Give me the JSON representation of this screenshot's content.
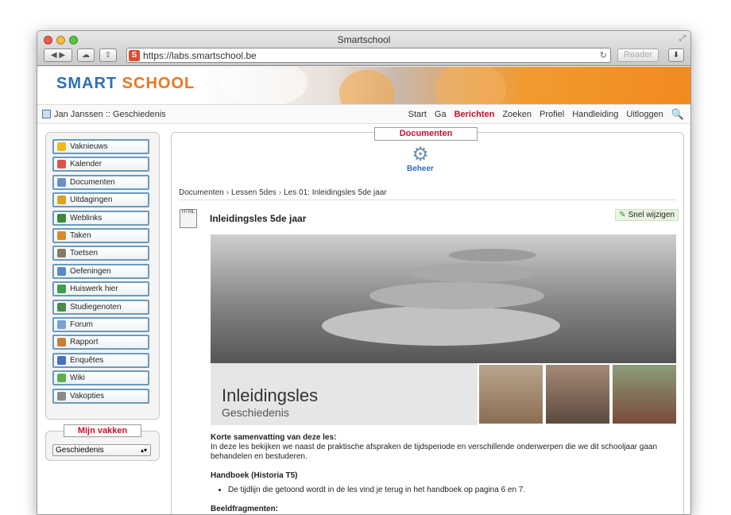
{
  "window": {
    "title": "Smartschool",
    "url": "https://labs.smartschool.be",
    "reader": "Reader"
  },
  "brand": {
    "logo_a": "SMART",
    "logo_b": "SCHOOL"
  },
  "userbar": {
    "user": "Jan Janssen :: Geschiedenis",
    "menu": [
      "Start",
      "Ga",
      "Berichten",
      "Zoeken",
      "Profiel",
      "Handleiding",
      "Uitloggen"
    ]
  },
  "sidebar": {
    "items": [
      {
        "label": "Vaknieuws",
        "color": "#f2b81c"
      },
      {
        "label": "Kalender",
        "color": "#d9534f"
      },
      {
        "label": "Documenten",
        "color": "#6a8fc4"
      },
      {
        "label": "Uitdagingen",
        "color": "#e0a020"
      },
      {
        "label": "Weblinks",
        "color": "#3a8a3a"
      },
      {
        "label": "Taken",
        "color": "#d88a2a"
      },
      {
        "label": "Toetsen",
        "color": "#8a7a6a"
      },
      {
        "label": "Oefeningen",
        "color": "#5a8ac4"
      },
      {
        "label": "Huiswerk hier",
        "color": "#3aa04a"
      },
      {
        "label": "Studiegenoten",
        "color": "#4a8a4a"
      },
      {
        "label": "Forum",
        "color": "#7aa0d4"
      },
      {
        "label": "Rapport",
        "color": "#c4803a"
      },
      {
        "label": "Enquêtes",
        "color": "#4a70c4"
      },
      {
        "label": "Wiki",
        "color": "#5ab04a"
      },
      {
        "label": "Vakopties",
        "color": "#8a8a8a"
      }
    ]
  },
  "vakken": {
    "title": "Mijn vakken",
    "selected": "Geschiedenis"
  },
  "content": {
    "title": "Documenten",
    "beheer": "Beheer",
    "breadcrumb": [
      "Documenten",
      "Lessen 5des",
      "Les 01: Inleidingsles 5de jaar"
    ],
    "doc_title": "Inleidingsles 5de jaar",
    "doc_icon": "HTML",
    "snel": "Snel wijzigen",
    "hero_title": "Inleidingsles",
    "hero_subtitle": "Geschiedenis",
    "summary_heading": "Korte samenvatting van deze les:",
    "summary_text": "In deze les bekijken we naast de praktische afspraken de tijdsperiode en verschillende onderwerpen die we dit schooljaar gaan behandelen en bestuderen.",
    "handboek_heading": "Handboek (Historia T5)",
    "handboek_item": "De tijdlijn die getoond wordt in de les vind je terug in het handboek op pagina 6 en 7.",
    "beeld_heading": "Beeldfragmenten:"
  }
}
